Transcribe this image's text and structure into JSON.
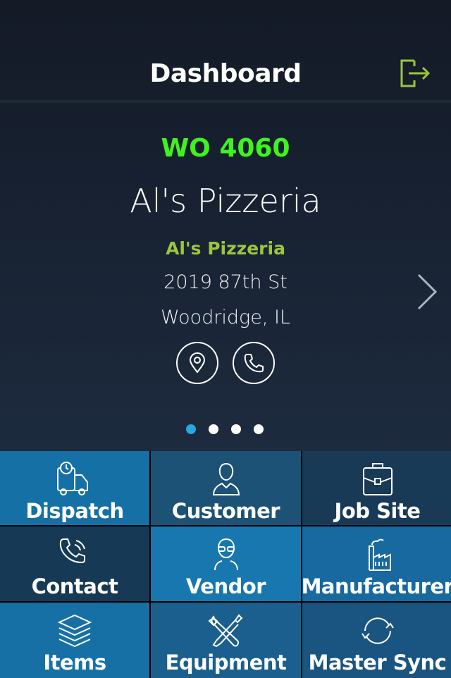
{
  "header": {
    "title": "Dashboard",
    "logout_icon": "logout-icon",
    "logout_color": "#9cc540"
  },
  "work_order": {
    "number": "WO 4060",
    "site_name": "Al's Pizzeria",
    "customer_name": "Al's Pizzeria",
    "address_line1": "2019 87th St",
    "address_line2": "Woodridge, IL",
    "page_index": 1,
    "page_count": 4
  },
  "colors": {
    "wo": "#3ef31e",
    "customer": "#9cc540",
    "active_dot": "#25a8e0"
  },
  "tiles": [
    {
      "label": "Dispatch",
      "icon": "truck-clock-icon",
      "color": "#1570a6"
    },
    {
      "label": "Customer",
      "icon": "person-icon",
      "color": "#1c5275"
    },
    {
      "label": "Job Site",
      "icon": "briefcase-icon",
      "color": "#183a57"
    },
    {
      "label": "Contact",
      "icon": "phone-icon",
      "color": "#163a56"
    },
    {
      "label": "Vendor",
      "icon": "person-glasses-icon",
      "color": "#1777ae"
    },
    {
      "label": "Manufacturer",
      "icon": "factory-icon",
      "color": "#1769a0"
    },
    {
      "label": "Items",
      "icon": "layers-icon",
      "color": "#1670a6"
    },
    {
      "label": "Equipment",
      "icon": "tools-icon",
      "color": "#1a5f8d"
    },
    {
      "label": "Master Sync",
      "icon": "sync-icon",
      "color": "#1a5480"
    }
  ]
}
